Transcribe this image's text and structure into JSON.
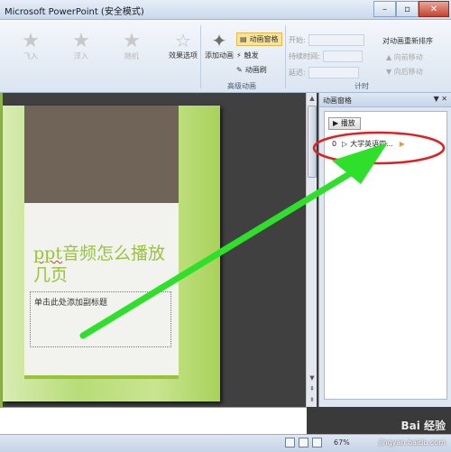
{
  "window": {
    "title": "Microsoft PowerPoint (安全模式)",
    "minimize": "–",
    "restore": "▫",
    "close": "✕"
  },
  "ribbon": {
    "effects": [
      {
        "label": "飞入"
      },
      {
        "label": "浮入"
      },
      {
        "label": "随机"
      }
    ],
    "effect_options": "效果选项",
    "add_animation": "添加动画",
    "animation_pane": "动画窗格",
    "trigger": "触发",
    "animation_painter": "动画刷",
    "group_advanced": "高级动画",
    "start_label": "开始:",
    "duration_label": "持续时间:",
    "delay_label": "延迟:",
    "group_timing": "计时",
    "reorder_title": "对动画重新排序",
    "move_earlier": "向前移动",
    "move_later": "向后移动"
  },
  "slide": {
    "title_prefix": "ppt",
    "title_rest": "音频怎么播放几页",
    "subtitle_placeholder": "单击此处添加副标题"
  },
  "pane": {
    "title": "动画窗格",
    "controls": "▼ ✕",
    "play_label": "▶ 播放",
    "items": [
      {
        "num": "0",
        "name": "大学英语四..."
      }
    ]
  },
  "status": {
    "zoom": "67%"
  },
  "watermark": "Bai 经验",
  "watermark_sub": "jingyan.baidu.com",
  "colors": {
    "slide_accent": "#99c23d",
    "annotation_green": "#2ee02a",
    "annotation_red": "#e02020"
  }
}
